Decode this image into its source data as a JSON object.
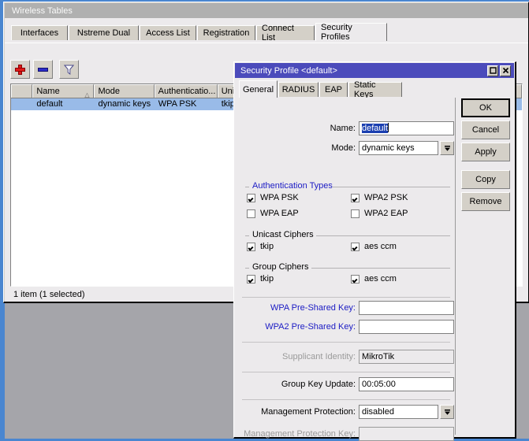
{
  "main_window": {
    "title": "Wireless Tables",
    "tabs": [
      {
        "label": "Interfaces",
        "active": false
      },
      {
        "label": "Nstreme Dual",
        "active": false
      },
      {
        "label": "Access List",
        "active": false
      },
      {
        "label": "Registration",
        "active": false
      },
      {
        "label": "Connect List",
        "active": false
      },
      {
        "label": "Security Profiles",
        "active": true
      }
    ],
    "toolbar": {
      "add_icon": "plus-icon",
      "remove_icon": "minus-icon",
      "filter_icon": "funnel-icon"
    },
    "table": {
      "columns": [
        "",
        "Name",
        "Mode",
        "Authenticatio...",
        "Uni"
      ],
      "sort_column": "Name",
      "sort_indicator": "△",
      "rows": [
        {
          "marker": "",
          "name": "default",
          "mode": "dynamic keys",
          "authentication": "WPA PSK",
          "unicast": "tkip"
        }
      ]
    },
    "status": "1 item (1 selected)"
  },
  "dialog": {
    "title": "Security Profile <default>",
    "window_buttons": {
      "maximize": "maximize-icon",
      "close": "close-icon"
    },
    "tabs": [
      {
        "label": "General",
        "active": true
      },
      {
        "label": "RADIUS",
        "active": false
      },
      {
        "label": "EAP",
        "active": false
      },
      {
        "label": "Static Keys",
        "active": false
      }
    ],
    "fields": {
      "name_label": "Name:",
      "name_value": "default",
      "mode_label": "Mode:",
      "mode_value": "dynamic keys",
      "wpa_psk_label": "WPA Pre-Shared Key:",
      "wpa_psk_value": "",
      "wpa2_psk_label": "WPA2 Pre-Shared Key:",
      "wpa2_psk_value": "",
      "supplicant_label": "Supplicant Identity:",
      "supplicant_value": "MikroTik",
      "group_key_label": "Group Key Update:",
      "group_key_value": "00:05:00",
      "mgmt_protection_label": "Management Protection:",
      "mgmt_protection_value": "disabled",
      "mgmt_protection_key_label": "Management Protection Key:",
      "mgmt_protection_key_value": ""
    },
    "groups": [
      {
        "title": "Authentication Types",
        "title_color": "#1b1bc4",
        "items": [
          {
            "label": "WPA PSK",
            "checked": true
          },
          {
            "label": "WPA2 PSK",
            "checked": true
          },
          {
            "label": "WPA EAP",
            "checked": false
          },
          {
            "label": "WPA2 EAP",
            "checked": false
          }
        ]
      },
      {
        "title": "Unicast Ciphers",
        "title_color": "#000000",
        "items": [
          {
            "label": "tkip",
            "checked": true
          },
          {
            "label": "aes ccm",
            "checked": true
          }
        ]
      },
      {
        "title": "Group Ciphers",
        "title_color": "#000000",
        "items": [
          {
            "label": "tkip",
            "checked": true
          },
          {
            "label": "aes ccm",
            "checked": true
          }
        ]
      }
    ],
    "buttons": [
      {
        "label": "OK",
        "default": true
      },
      {
        "label": "Cancel",
        "default": false
      },
      {
        "label": "Apply",
        "default": false
      },
      {
        "label": "Copy",
        "default": false
      },
      {
        "label": "Remove",
        "default": false
      }
    ]
  },
  "colors": {
    "desktop": "#4a86d0",
    "desktop_grey": "#a5a5aa",
    "dialog_titlebar": "#4b4bbb",
    "main_titlebar": "#b0b0b0",
    "selection": "#99bbe8",
    "face": "#d4d0c8",
    "panel": "#eceaec",
    "blue_label": "#1b1bc4"
  }
}
